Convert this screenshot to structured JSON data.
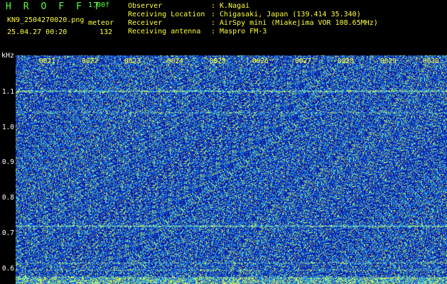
{
  "header": {
    "title": "H R O F F T",
    "version": "1.00f",
    "filename": "KN9_2504270020.png",
    "datetime": "25.04.27 00:20",
    "meteor_label": "meteor",
    "meteor_count": "132",
    "info_labels": [
      "Observer",
      "Receiving Location",
      "Receiver",
      "Receiving antenna"
    ],
    "info_values": [
      ": K.Nagai",
      ": Chigasaki, Japan (139.414 35.340)",
      ": AirSpy mini (Miakejima VOR 108.65MHz)",
      ": Maspro FM-3"
    ]
  },
  "axis": {
    "y_unit": "kHz",
    "y_ticks": [
      "1.1",
      "1.0",
      "0.9",
      "0.8",
      "0.7",
      "0.6"
    ],
    "x_ticks": [
      "0021",
      "0022",
      "0023",
      "0024",
      "0025",
      "0026",
      "0027",
      "0028",
      "0029",
      "0030"
    ]
  },
  "colors": {
    "background": "#000000",
    "waterfall_base": "#0a1aa8",
    "signal": "#ffff3c",
    "text_green": "#5cff3a"
  }
}
